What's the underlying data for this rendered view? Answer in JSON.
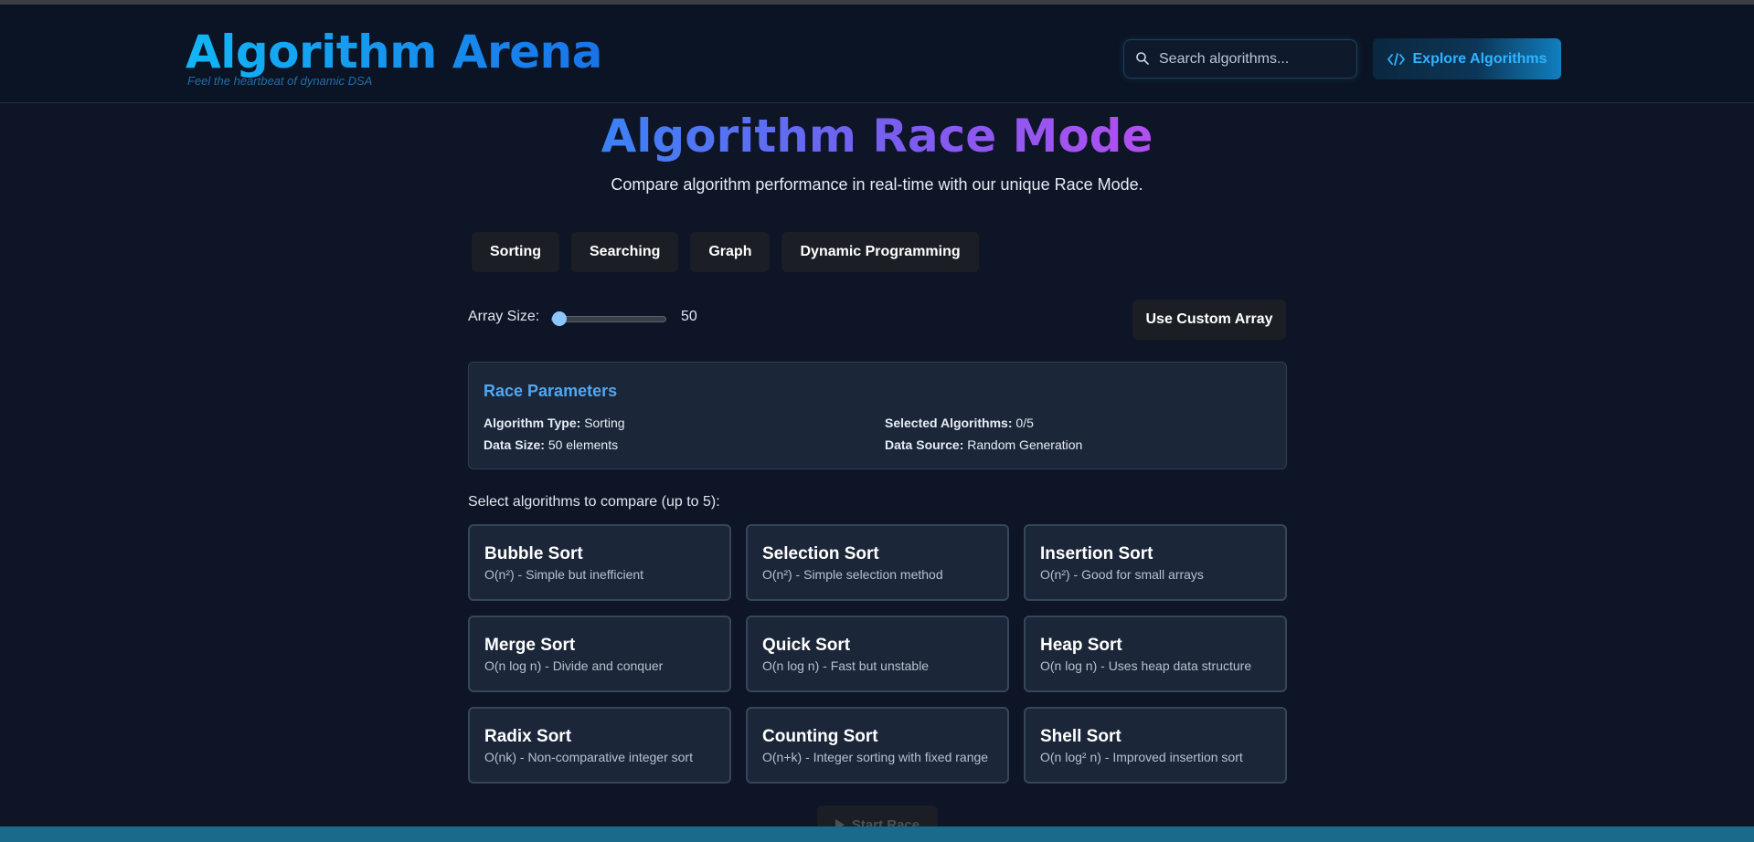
{
  "header": {
    "brand_title": "Algorithm Arena",
    "brand_tagline": "Feel the heartbeat of dynamic DSA",
    "search_placeholder": "Search algorithms...",
    "explore_label": "Explore Algorithms"
  },
  "race": {
    "title": "Algorithm Race Mode",
    "subtitle": "Compare algorithm performance in real-time with our unique Race Mode."
  },
  "tabs": [
    {
      "label": "Sorting"
    },
    {
      "label": "Searching"
    },
    {
      "label": "Graph"
    },
    {
      "label": "Dynamic Programming"
    }
  ],
  "controls": {
    "array_size_label": "Array Size:",
    "array_size_value": "50",
    "custom_array_label": "Use Custom Array"
  },
  "parameters": {
    "title": "Race Parameters",
    "algorithm_type_label": "Algorithm Type:",
    "algorithm_type_value": "Sorting",
    "selected_label": "Selected Algorithms:",
    "selected_value": "0/5",
    "data_size_label": "Data Size:",
    "data_size_value": "50 elements",
    "data_source_label": "Data Source:",
    "data_source_value": "Random Generation"
  },
  "select_prompt": "Select algorithms to compare (up to 5):",
  "algorithms": [
    {
      "name": "Bubble Sort",
      "desc": "O(n²) - Simple but inefficient"
    },
    {
      "name": "Selection Sort",
      "desc": "O(n²) - Simple selection method"
    },
    {
      "name": "Insertion Sort",
      "desc": "O(n²) - Good for small arrays"
    },
    {
      "name": "Merge Sort",
      "desc": "O(n log n) - Divide and conquer"
    },
    {
      "name": "Quick Sort",
      "desc": "O(n log n) - Fast but unstable"
    },
    {
      "name": "Heap Sort",
      "desc": "O(n log n) - Uses heap data structure"
    },
    {
      "name": "Radix Sort",
      "desc": "O(nk) - Non-comparative integer sort"
    },
    {
      "name": "Counting Sort",
      "desc": "O(n+k) - Integer sorting with fixed range"
    },
    {
      "name": "Shell Sort",
      "desc": "O(n log² n) - Improved insertion sort"
    }
  ],
  "start_label": "Start Race",
  "colors": {
    "background": "#0d1526",
    "accent_blue": "#1a73e8",
    "param_title": "#4ea8f5",
    "race_gradient_start": "#3b82f6",
    "race_gradient_end": "#b34ff0"
  },
  "icons": {
    "search": "search-icon",
    "explore": "code-icon",
    "start": "play-icon"
  }
}
